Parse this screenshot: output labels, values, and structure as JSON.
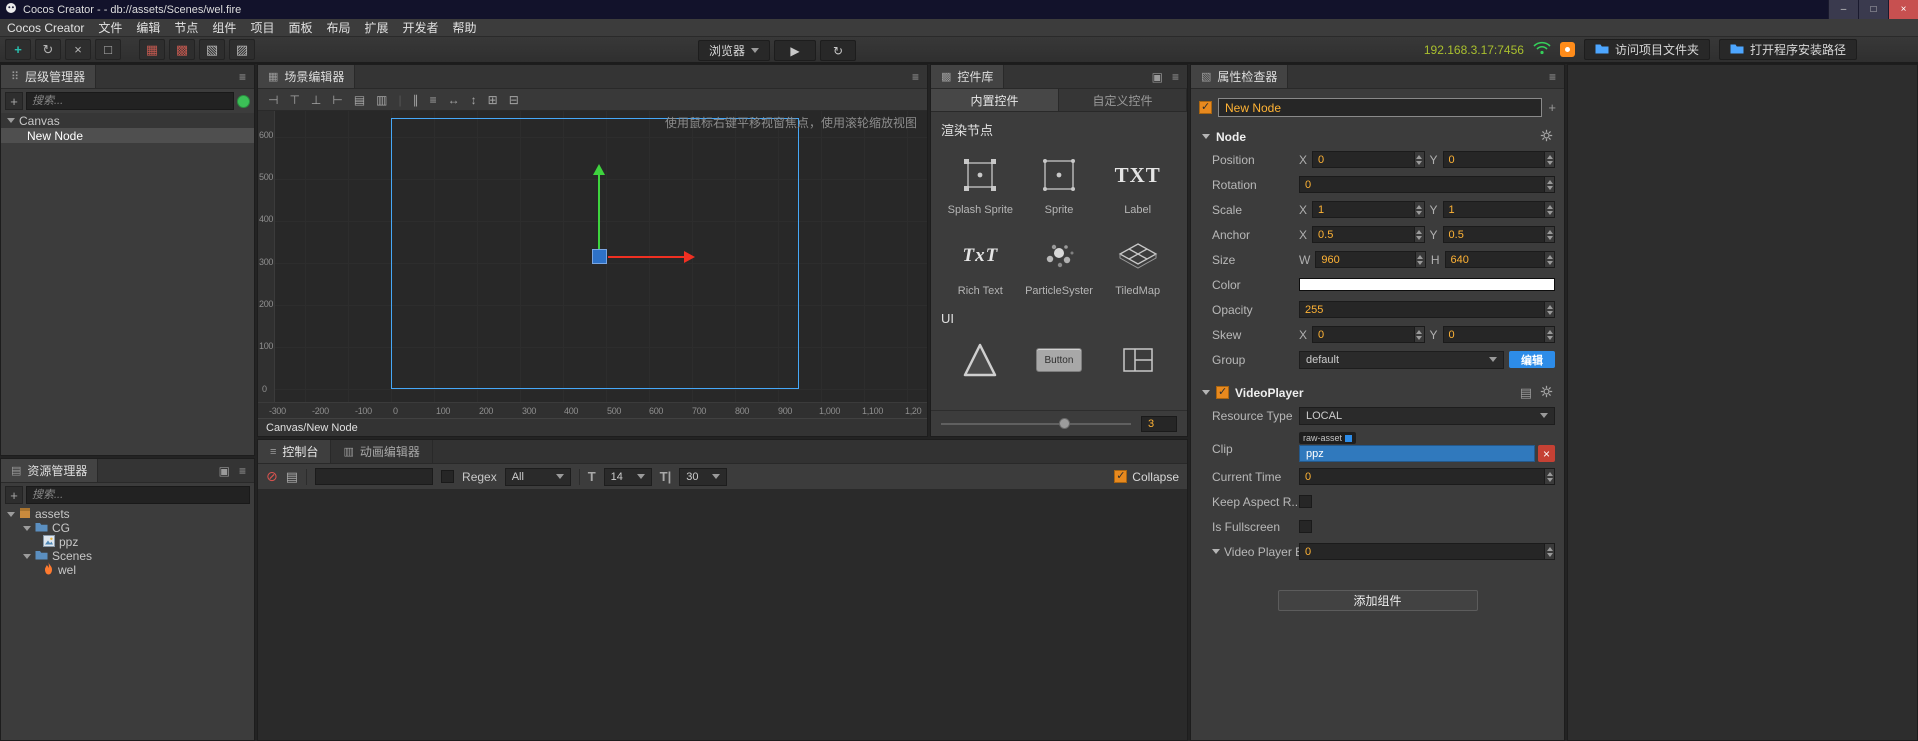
{
  "colors": {
    "accent_orange": "#e8891e",
    "value_text_orange": "#ffb335",
    "selection_blue": "#3079bd",
    "design_rect_blue": "#46a8f8",
    "gizmo_green": "#3ed33e",
    "gizmo_red": "#f03022",
    "titlebar_navy": "#12122b"
  },
  "titlebar": {
    "title": "Cocos Creator -  - db://assets/Scenes/wel.fire"
  },
  "menubar": {
    "items": [
      "Cocos Creator",
      "文件",
      "编辑",
      "节点",
      "组件",
      "项目",
      "面板",
      "布局",
      "扩展",
      "开发者",
      "帮助"
    ]
  },
  "toolbar": {
    "preview_target": "浏览器",
    "ip": "192.168.3.17:7456",
    "open_project_folder": "访问项目文件夹",
    "open_install_path": "打开程序安装路径"
  },
  "hierarchy": {
    "title": "层级管理器",
    "search_placeholder": "搜索...",
    "nodes": [
      {
        "label": "Canvas"
      },
      {
        "label": "New Node"
      }
    ]
  },
  "assets": {
    "title": "资源管理器",
    "search_placeholder": "搜索...",
    "items": [
      "assets",
      "CG",
      "ppz",
      "Scenes",
      "wel"
    ]
  },
  "scene": {
    "title": "场景编辑器",
    "hint": "使用鼠标右键平移视窗焦点，使用滚轮缩放视图",
    "breadcrumb": "Canvas/New Node",
    "ruler_y": [
      "600",
      "500",
      "400",
      "300",
      "200",
      "100",
      "0"
    ],
    "ruler_x": [
      "-300",
      "-200",
      "-100",
      "0",
      "100",
      "200",
      "300",
      "400",
      "500",
      "600",
      "700",
      "800",
      "900",
      "1,000",
      "1,100",
      "1,20"
    ]
  },
  "widgets": {
    "title": "控件库",
    "tabs": [
      "内置控件",
      "自定义控件"
    ],
    "render_section": "渲染节点",
    "render_items": [
      "Splash Sprite",
      "Sprite",
      "Label",
      "Rich Text",
      "ParticleSyster",
      "TiledMap"
    ],
    "label_icon_text": "TXT",
    "richtext_icon_text": "TxT",
    "ui_section": "UI",
    "button_widget_label": "Button",
    "slider_value": "3"
  },
  "console": {
    "tabs": [
      "控制台",
      "动画编辑器"
    ],
    "regex_label": "Regex",
    "filter_value": "All",
    "font_size_value": "14",
    "line_height_value": "30",
    "collapse_label": "Collapse"
  },
  "inspector": {
    "title": "属性检查器",
    "node_name": "New Node",
    "node_section": {
      "title": "Node",
      "x_label": "X",
      "y_label": "Y",
      "w_label": "W",
      "h_label": "H",
      "position_label": "Position",
      "position_x": "0",
      "position_y": "0",
      "rotation_label": "Rotation",
      "rotation": "0",
      "scale_label": "Scale",
      "scale_x": "1",
      "scale_y": "1",
      "anchor_label": "Anchor",
      "anchor_x": "0.5",
      "anchor_y": "0.5",
      "size_label": "Size",
      "size_w": "960",
      "size_h": "640",
      "color_label": "Color",
      "color_value": "#FFFFFF",
      "opacity_label": "Opacity",
      "opacity": "255",
      "skew_label": "Skew",
      "skew_x": "0",
      "skew_y": "0",
      "group_label": "Group",
      "group_value": "default",
      "group_edit_label": "编辑"
    },
    "video_section": {
      "title": "VideoPlayer",
      "resource_type_label": "Resource Type",
      "resource_type": "LOCAL",
      "clip_label": "Clip",
      "clip_asset_type": "raw-asset",
      "clip_value": "ppz",
      "current_time_label": "Current Time",
      "current_time": "0",
      "keep_aspect_label": "Keep Aspect R...",
      "fullscreen_label": "Is Fullscreen",
      "events_label": "Video Player E...",
      "events_value": "0"
    },
    "add_component_label": "添加组件"
  }
}
